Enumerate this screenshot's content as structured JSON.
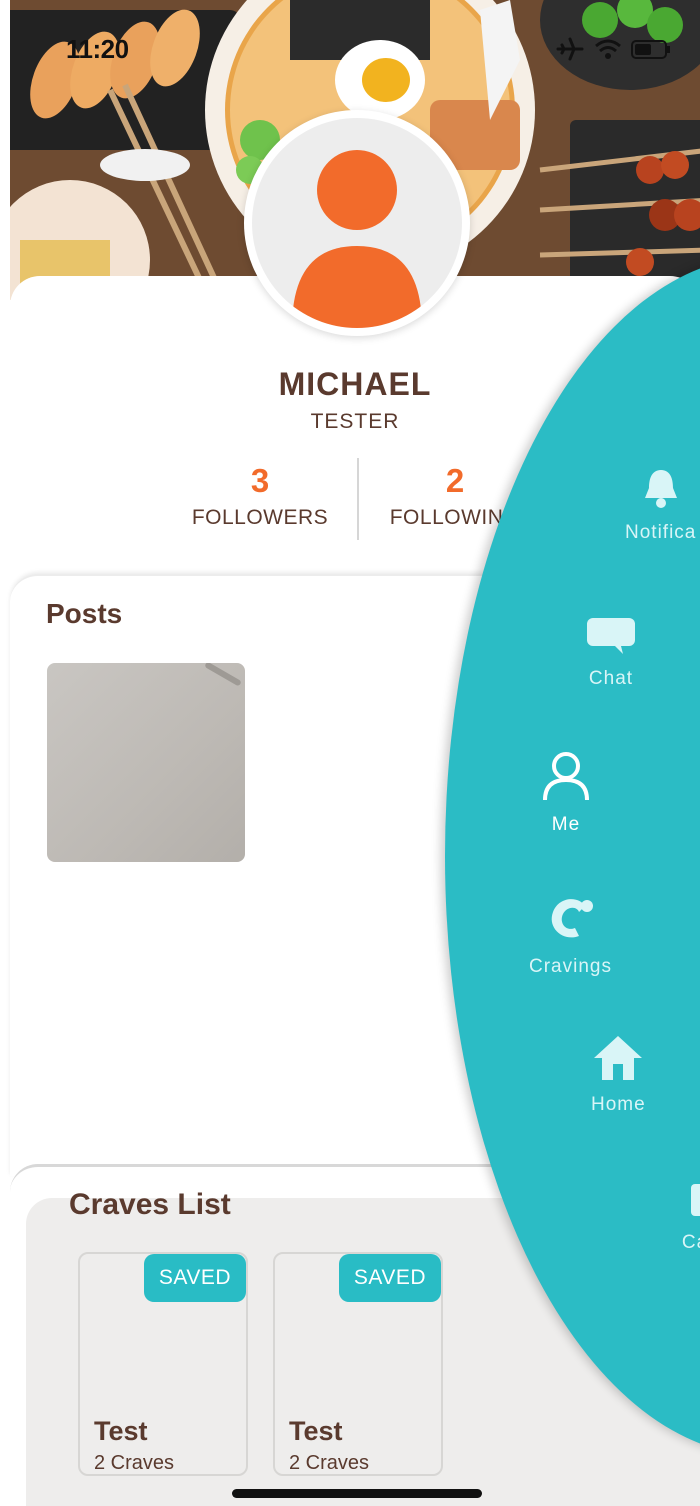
{
  "status_bar": {
    "time": "11:20"
  },
  "profile": {
    "name": "MICHAEL",
    "subtitle": "TESTER",
    "followers_count": "3",
    "followers_label": "FOLLOWERS",
    "following_count": "2",
    "following_label": "FOLLOWING"
  },
  "more_label": "•••",
  "posts": {
    "title": "Posts"
  },
  "craves": {
    "title": "Craves List",
    "items": [
      {
        "badge": "SAVED",
        "name": "Test",
        "count": "2 Craves"
      },
      {
        "badge": "SAVED",
        "name": "Test",
        "count": "2 Craves"
      }
    ]
  },
  "menu": {
    "items": [
      {
        "label": "Notifica",
        "icon": "bell-icon"
      },
      {
        "label": "Chat",
        "icon": "chat-icon"
      },
      {
        "label": "Me",
        "icon": "person-icon",
        "active": true
      },
      {
        "label": "Cravings",
        "icon": "cravings-logo-icon"
      },
      {
        "label": "Home",
        "icon": "home-icon"
      },
      {
        "label": "Ca",
        "icon": "camera-icon"
      }
    ]
  },
  "colors": {
    "accent_teal": "#2bbcc5",
    "accent_orange": "#f26b2b",
    "text_brown": "#5a3a2e"
  }
}
